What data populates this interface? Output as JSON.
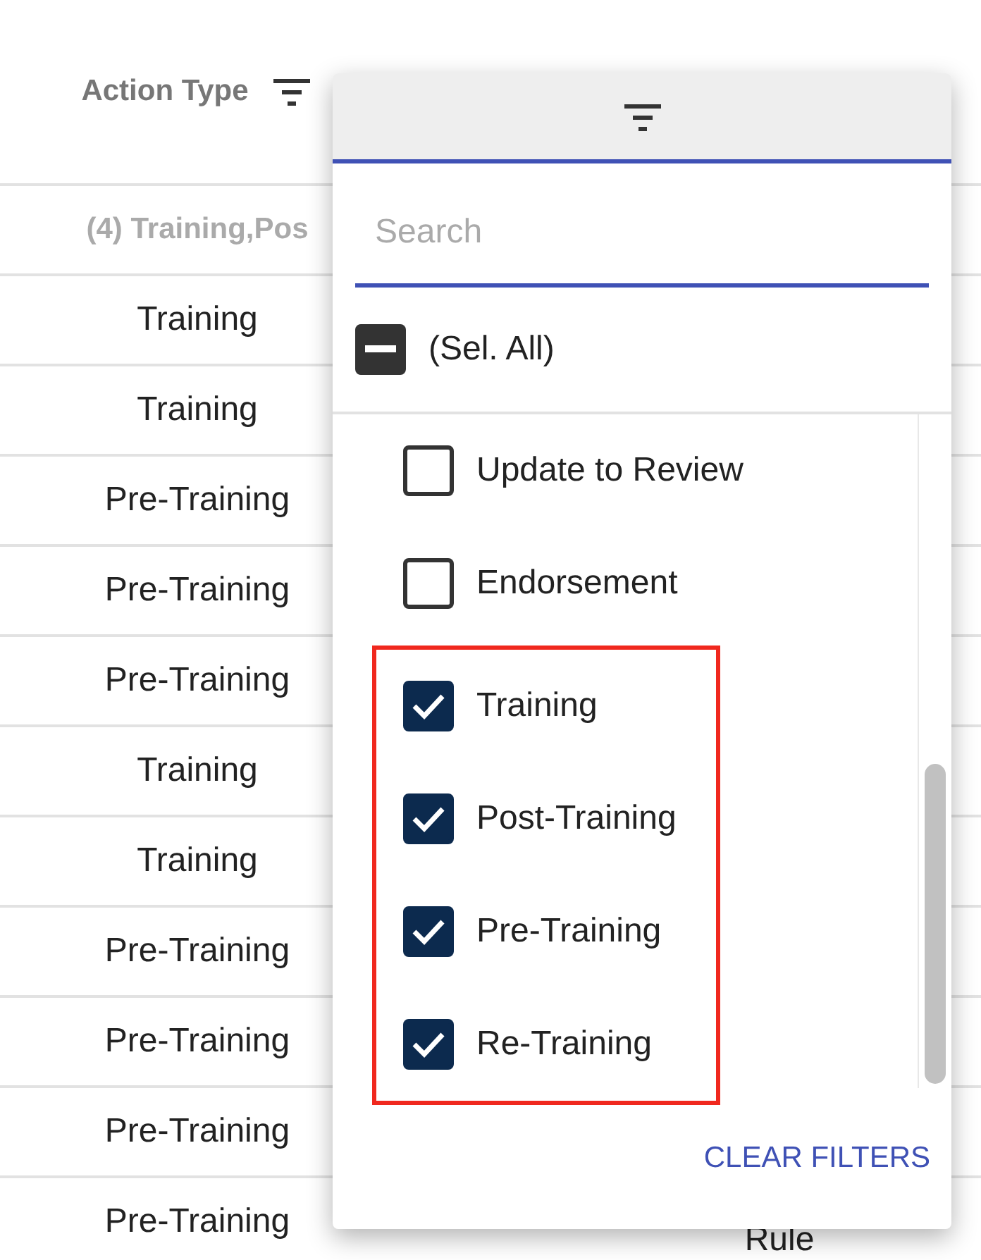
{
  "table": {
    "columns": [
      {
        "label": "Action Type"
      }
    ],
    "filter_row": "(4) Training,Pos",
    "rows": [
      {
        "column_1": "Training"
      },
      {
        "column_1": "Training"
      },
      {
        "column_1": "Pre-Training"
      },
      {
        "column_1": "Pre-Training"
      },
      {
        "column_1": "Pre-Training"
      },
      {
        "column_1": "Training"
      },
      {
        "column_1": "Training"
      },
      {
        "column_1": "Pre-Training"
      },
      {
        "column_1": "Pre-Training"
      },
      {
        "column_1": "Pre-Training"
      },
      {
        "column_1": "Pre-Training",
        "column_2": "Rule"
      }
    ]
  },
  "filter_popup": {
    "search": {
      "placeholder": "Search"
    },
    "select_all": {
      "label": "(Sel. All)",
      "indeterminate": true
    },
    "items": [
      {
        "label": "Update to Review",
        "checked": false,
        "highlighted": false
      },
      {
        "label": "Endorsement",
        "checked": false,
        "highlighted": false
      },
      {
        "label": "Training",
        "checked": true,
        "highlighted": true
      },
      {
        "label": "Post-Training",
        "checked": true,
        "highlighted": true
      },
      {
        "label": "Pre-Training",
        "checked": true,
        "highlighted": true
      },
      {
        "label": "Re-Training",
        "checked": true,
        "highlighted": true
      }
    ],
    "clear_button": "CLEAR FILTERS"
  }
}
